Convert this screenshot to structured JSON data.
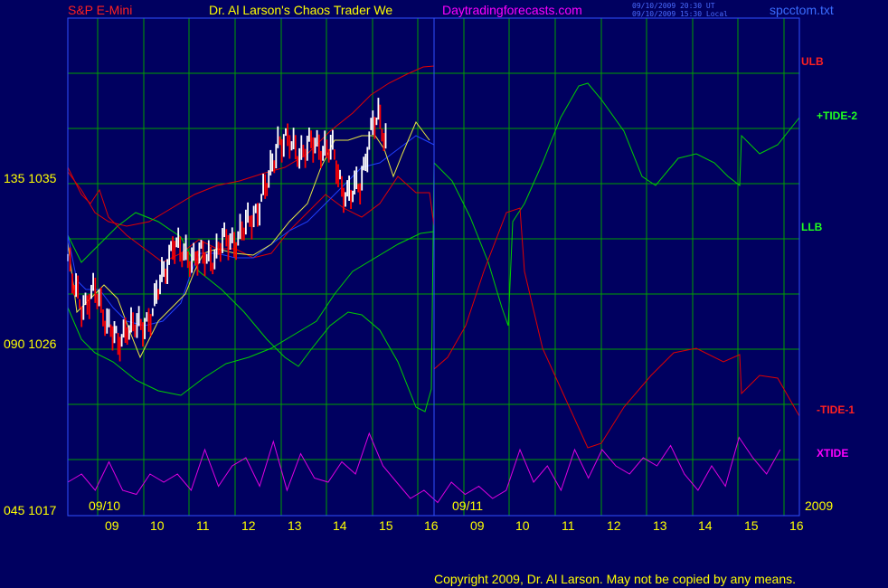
{
  "header": {
    "symbol": "S&P E-Mini",
    "title": "Dr. Al Larson's Chaos Trader We",
    "website": "Daytradingforecasts.com",
    "timestamp_ut": "09/10/2009 20:30 UT",
    "timestamp_local": "09/10/2009 15:30 Local",
    "filename": "spcctom.txt"
  },
  "footer": {
    "copyright": "Copyright 2009, Dr. Al Larson. May not be copied by any means."
  },
  "colors": {
    "background": "#000060",
    "grid": "#00a000",
    "price_up": "#ffffff",
    "price_down": "#ff0000",
    "red_line": "#e00000",
    "green_line": "#00d000",
    "blue_line": "#2040ff",
    "xtide": "#e000e0",
    "yellow_line": "#e8e840"
  },
  "chart_data": {
    "type": "line",
    "y_ticks": [
      {
        "label": "135 1035",
        "value": 1035
      },
      {
        "label": "090 1026",
        "value": 1026
      },
      {
        "label": "045 1017",
        "value": 1017
      }
    ],
    "x_ticks": [
      "09",
      "10",
      "11",
      "12",
      "13",
      "14",
      "15",
      "16",
      "09",
      "10",
      "11",
      "12",
      "13",
      "14",
      "15",
      "16"
    ],
    "date_labels": [
      "09/10",
      "09/11",
      "2009"
    ],
    "ylim": [
      1017,
      1044
    ],
    "series": [
      {
        "name": "ULB",
        "color": "#e00000"
      },
      {
        "name": "+TIDE-2",
        "color": "#00d000"
      },
      {
        "name": "LLB",
        "color": "#00d000"
      },
      {
        "name": "-TIDE-1",
        "color": "#e00000"
      },
      {
        "name": "XTIDE",
        "color": "#e000e0"
      }
    ],
    "price_path": [
      [
        0,
        1031.0
      ],
      [
        0.1,
        1029.5
      ],
      [
        0.3,
        1028.5
      ],
      [
        0.6,
        1029.0
      ],
      [
        0.9,
        1027.5
      ],
      [
        1.1,
        1026.0
      ],
      [
        1.3,
        1027.5
      ],
      [
        1.6,
        1027.0
      ],
      [
        1.9,
        1028.5
      ],
      [
        2.1,
        1030.0
      ],
      [
        2.3,
        1032.0
      ],
      [
        2.5,
        1031.0
      ],
      [
        2.8,
        1031.2
      ],
      [
        3.0,
        1030.8
      ],
      [
        3.3,
        1031.5
      ],
      [
        3.6,
        1032.0
      ],
      [
        3.9,
        1032.5
      ],
      [
        4.2,
        1034.0
      ],
      [
        4.4,
        1035.0
      ],
      [
        4.6,
        1037.5
      ],
      [
        4.9,
        1037.0
      ],
      [
        5.2,
        1036.8
      ],
      [
        5.5,
        1037.2
      ],
      [
        5.8,
        1036.6
      ],
      [
        6.0,
        1035.0
      ],
      [
        6.2,
        1034.2
      ],
      [
        6.4,
        1035.0
      ],
      [
        6.6,
        1037.5
      ],
      [
        6.8,
        1038.5
      ],
      [
        7.0,
        1037.5
      ]
    ],
    "xtide_values": [
      [
        0,
        0.3
      ],
      [
        0.3,
        0.4
      ],
      [
        0.6,
        0.2
      ],
      [
        0.9,
        0.55
      ],
      [
        1.2,
        0.2
      ],
      [
        1.5,
        0.15
      ],
      [
        1.8,
        0.4
      ],
      [
        2.1,
        0.3
      ],
      [
        2.4,
        0.4
      ],
      [
        2.7,
        0.2
      ],
      [
        3.0,
        0.7
      ],
      [
        3.3,
        0.25
      ],
      [
        3.6,
        0.5
      ],
      [
        3.9,
        0.6
      ],
      [
        4.2,
        0.25
      ],
      [
        4.5,
        0.8
      ],
      [
        4.8,
        0.2
      ],
      [
        5.1,
        0.65
      ],
      [
        5.4,
        0.35
      ],
      [
        5.7,
        0.3
      ],
      [
        6.0,
        0.55
      ],
      [
        6.3,
        0.4
      ],
      [
        6.6,
        0.9
      ],
      [
        6.9,
        0.5
      ],
      [
        7.2,
        0.3
      ],
      [
        7.5,
        0.1
      ],
      [
        7.8,
        0.2
      ],
      [
        8.1,
        0.05
      ],
      [
        8.4,
        0.3
      ],
      [
        8.7,
        0.15
      ],
      [
        9.0,
        0.25
      ],
      [
        9.3,
        0.1
      ],
      [
        9.6,
        0.2
      ],
      [
        9.9,
        0.7
      ],
      [
        10.2,
        0.3
      ],
      [
        10.5,
        0.5
      ],
      [
        10.8,
        0.2
      ],
      [
        11.1,
        0.7
      ],
      [
        11.4,
        0.35
      ],
      [
        11.7,
        0.7
      ],
      [
        12.0,
        0.5
      ],
      [
        12.3,
        0.4
      ],
      [
        12.6,
        0.6
      ],
      [
        12.9,
        0.5
      ],
      [
        13.2,
        0.75
      ],
      [
        13.5,
        0.4
      ],
      [
        13.8,
        0.2
      ],
      [
        14.1,
        0.5
      ],
      [
        14.4,
        0.25
      ],
      [
        14.7,
        0.85
      ],
      [
        15.0,
        0.6
      ],
      [
        15.3,
        0.4
      ],
      [
        15.6,
        0.7
      ]
    ]
  }
}
